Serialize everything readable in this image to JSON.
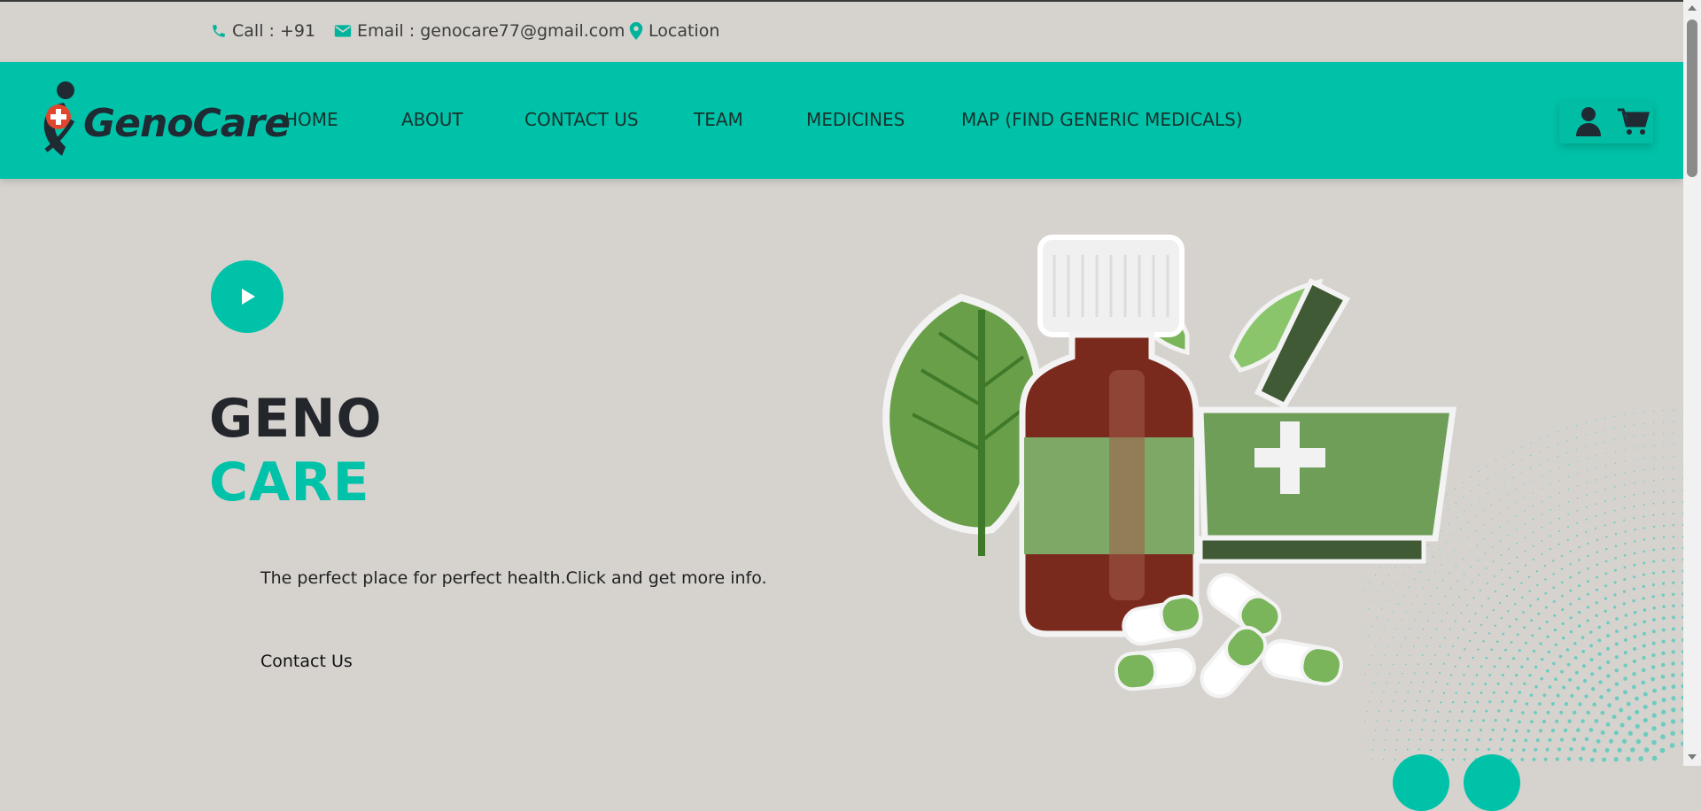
{
  "topbar": {
    "phone": "Call : +91",
    "email": "Email : genocare77@gmail.com",
    "location": "Location",
    "icons": [
      "phone-icon",
      "envelope-icon",
      "map-pin-icon"
    ]
  },
  "brand": {
    "name": "GenoCare"
  },
  "nav": {
    "items": [
      {
        "label": "HOME"
      },
      {
        "label": "ABOUT"
      },
      {
        "label": "CONTACT US"
      },
      {
        "label": "TEAM"
      },
      {
        "label": "MEDICINES"
      },
      {
        "label": "MAP (FIND GENERIC MEDICALS)"
      }
    ],
    "actions": [
      "user-icon",
      "cart-icon"
    ]
  },
  "hero": {
    "title_line1": "GENO",
    "title_line2": "CARE",
    "tagline": "The perfect place for perfect health.Click and get more info.",
    "contact_label": "Contact Us"
  },
  "colors": {
    "accent": "#00c2a8",
    "background": "#d6d3cf",
    "title_dark": "#23262b"
  }
}
